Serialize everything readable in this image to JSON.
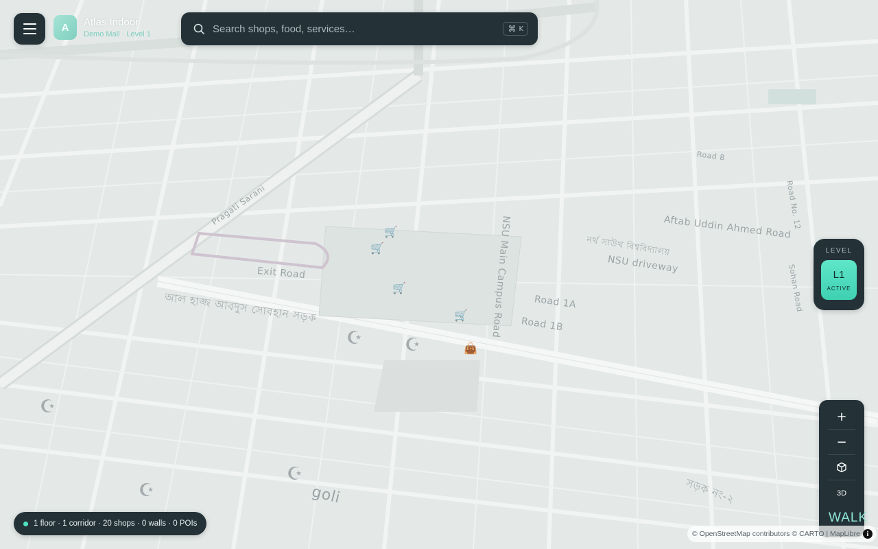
{
  "app": {
    "title": "Atlas Indoor",
    "subtitle": "Demo Mall · Level 1",
    "logo_letter": "A"
  },
  "search": {
    "placeholder": "Search shops, food, services…",
    "shortcut_symbol": "⌘",
    "shortcut_key": "K"
  },
  "level": {
    "title": "LEVEL",
    "current": "L1",
    "state": "ACTIVE"
  },
  "controls": {
    "zoom_in": "+",
    "zoom_out": "−",
    "view_3d": "3D",
    "walk": "WALK"
  },
  "status": {
    "summary": "1 floor · 1 corridor · 20 shops · 0 walls · 0 POIs"
  },
  "attribution": {
    "text": "© OpenStreetMap contributors © CARTO | MapLibre"
  },
  "map": {
    "labels": [
      {
        "text": "Exit Road"
      },
      {
        "text": "NSU Main Campus Road"
      },
      {
        "text": "NSU driveway"
      },
      {
        "text": "Aftab Uddin Ahmed Road"
      },
      {
        "text": "Road 1A"
      },
      {
        "text": "Road 1B"
      },
      {
        "text": "Road 8"
      },
      {
        "text": "Road No. 12"
      },
      {
        "text": "Sohan Road"
      },
      {
        "text": "Pragati Sarani"
      },
      {
        "text": "goli"
      },
      {
        "text": "আল হাজ্জ আবদুস সোবহান সড়ক"
      },
      {
        "text": "নর্থ সাউথ বিশ্ববিদ্যালয়"
      },
      {
        "text": "সড়ক নং-২"
      }
    ]
  },
  "colors": {
    "panel": "#243238",
    "accent": "#4fd6b9",
    "map_background": "#e6ebea"
  }
}
